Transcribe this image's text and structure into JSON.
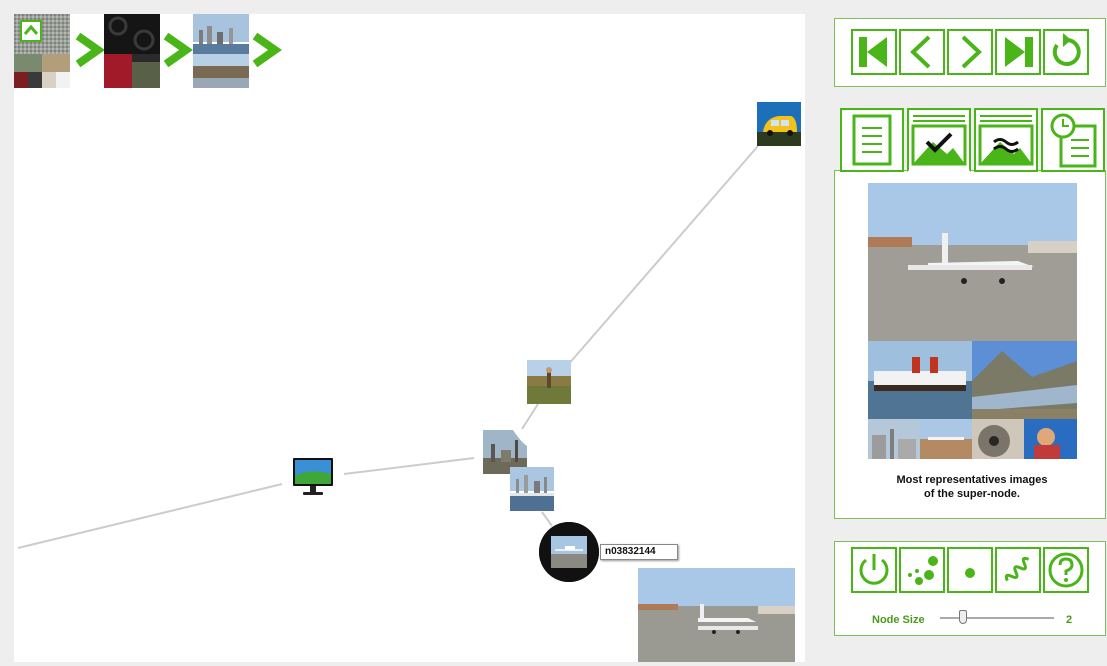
{
  "graph": {
    "hovered_node_id": "n03832144",
    "nodes": [
      {
        "name": "van-thumbnail",
        "subject": "yellow van"
      },
      {
        "name": "field-worker-thumbnail",
        "subject": "person in field"
      },
      {
        "name": "industrial-thumbnail",
        "subject": "industrial site"
      },
      {
        "name": "harbor-thumbnail",
        "subject": "harbor"
      },
      {
        "name": "monitor-thumbnail",
        "subject": "computer monitor"
      },
      {
        "name": "airplane-node",
        "subject": "small airplane"
      },
      {
        "name": "airplane-preview",
        "subject": "small airplane on tarmac"
      }
    ]
  },
  "breadcrumb": {
    "items": [
      "textures",
      "patterns",
      "cityscape"
    ]
  },
  "toolbar": {
    "buttons": [
      "first",
      "previous",
      "next",
      "last",
      "reset"
    ]
  },
  "tabs": {
    "items": [
      "document",
      "image-check",
      "image-similar",
      "history"
    ],
    "active": "image-check"
  },
  "info_panel": {
    "caption_line1": "Most representatives images",
    "caption_line2": "of the super-node."
  },
  "controls": {
    "buttons": [
      "power",
      "scatter",
      "single-node",
      "spring",
      "help"
    ],
    "node_size_label": "Node Size",
    "node_size_value": "2",
    "node_size_fraction": 0.2
  },
  "colors": {
    "accent": "#4ab518",
    "edge": "#cccccc",
    "panel_border": "#7bc05a"
  }
}
